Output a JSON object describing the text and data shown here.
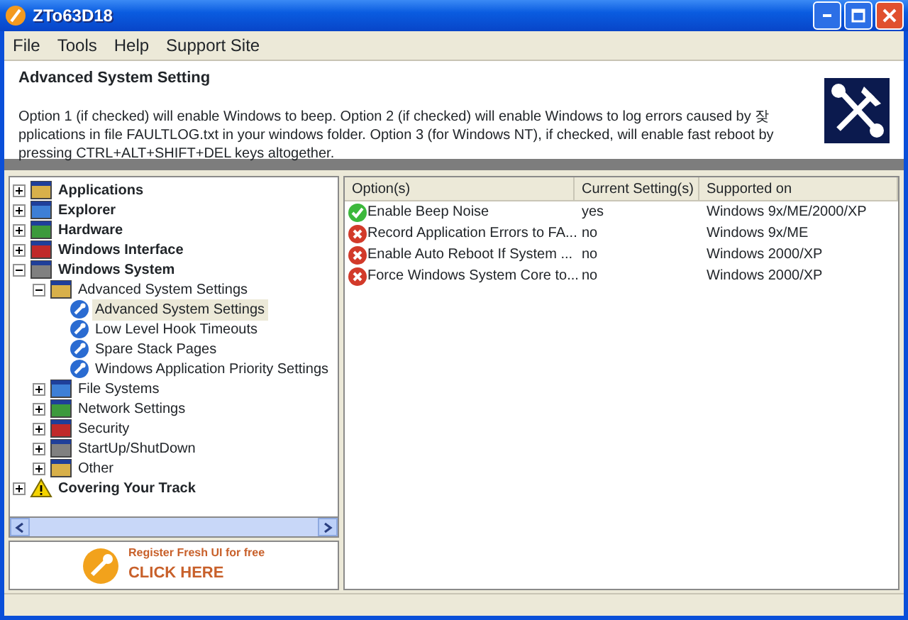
{
  "window": {
    "title": "ZTo63D18"
  },
  "menu": [
    "File",
    "Tools",
    "Help",
    "Support Site"
  ],
  "header": {
    "title": "Advanced System Setting",
    "description": "Option 1 (if checked) will enable Windows to beep.  Option 2 (if checked) will enable Windows to log errors caused by 잦pplications in file FAULTLOG.txt in your windows folder.  Option 3 (for Windows NT), if checked, will enable fast reboot by pressing CTRL+ALT+SHIFT+DEL keys altogether."
  },
  "tree": [
    {
      "label": "Applications",
      "expanded": false,
      "selected": false
    },
    {
      "label": "Explorer",
      "expanded": false,
      "selected": false
    },
    {
      "label": "Hardware",
      "expanded": false,
      "selected": false
    },
    {
      "label": "Windows Interface",
      "expanded": false,
      "selected": false
    },
    {
      "label": "Windows System",
      "expanded": true,
      "selected": false,
      "children": [
        {
          "label": "Advanced System Settings",
          "expanded": true,
          "selected": false,
          "children": [
            {
              "label": "Advanced System Settings",
              "selected": true
            },
            {
              "label": "Low Level Hook Timeouts",
              "selected": false
            },
            {
              "label": "Spare Stack Pages",
              "selected": false
            },
            {
              "label": "Windows Application Priority Settings",
              "selected": false
            }
          ]
        },
        {
          "label": "File Systems",
          "expanded": false,
          "selected": false
        },
        {
          "label": "Network Settings",
          "expanded": false,
          "selected": false
        },
        {
          "label": "Security",
          "expanded": false,
          "selected": false
        },
        {
          "label": "StartUp/ShutDown",
          "expanded": false,
          "selected": false
        },
        {
          "label": "Other",
          "expanded": false,
          "selected": false
        }
      ]
    },
    {
      "label": "Covering Your Track",
      "expanded": false,
      "selected": false
    }
  ],
  "banner": {
    "line1": "Register Fresh UI for free",
    "line2": "CLICK HERE"
  },
  "table": {
    "columns": [
      "Option(s)",
      "Current Setting(s)",
      "Supported on"
    ],
    "rows": [
      {
        "enabled": true,
        "cells": [
          "Enable Beep Noise",
          "yes",
          "Windows 9x/ME/2000/XP"
        ]
      },
      {
        "enabled": false,
        "cells": [
          "Record Application Errors to FA...",
          "no",
          "Windows 9x/ME"
        ]
      },
      {
        "enabled": false,
        "cells": [
          "Enable Auto Reboot If System ...",
          "no",
          "Windows 2000/XP"
        ]
      },
      {
        "enabled": false,
        "cells": [
          "Force Windows System Core to...",
          "no",
          "Windows 2000/XP"
        ]
      }
    ]
  }
}
